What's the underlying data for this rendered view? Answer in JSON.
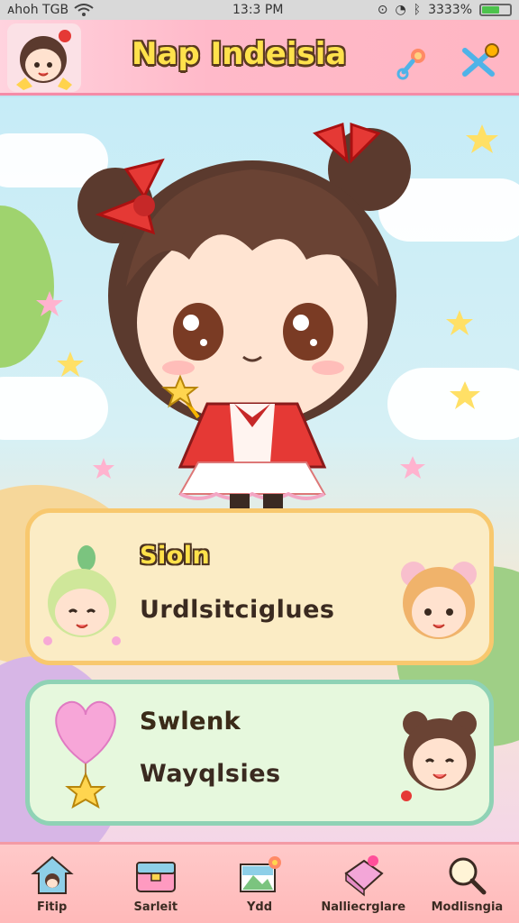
{
  "status_bar": {
    "carrier": "ᴀhoh TGB",
    "time": "13:3 PM",
    "battery": "3333%"
  },
  "header": {
    "title": "Nap Indeisia"
  },
  "cards": [
    {
      "title": "Sioln",
      "subtitle": "Urdlsitciglues"
    },
    {
      "title": "Swlenk",
      "subtitle": "Wayqlsies"
    }
  ],
  "nav": {
    "items": [
      {
        "label": "Fitip",
        "icon": "house-icon"
      },
      {
        "label": "Sarleit",
        "icon": "chest-icon"
      },
      {
        "label": "Ydd",
        "icon": "photo-icon"
      },
      {
        "label": "Nalliecrglare",
        "icon": "gift-icon"
      },
      {
        "label": "Modlisngia",
        "icon": "search-icon"
      }
    ]
  },
  "colors": {
    "header_bg": "#ffb9c9",
    "title_fill": "#ffe24c",
    "card1_border": "#f8c86e",
    "card2_border": "#8fd2b5",
    "nav_bg": "#ffc2c2"
  }
}
